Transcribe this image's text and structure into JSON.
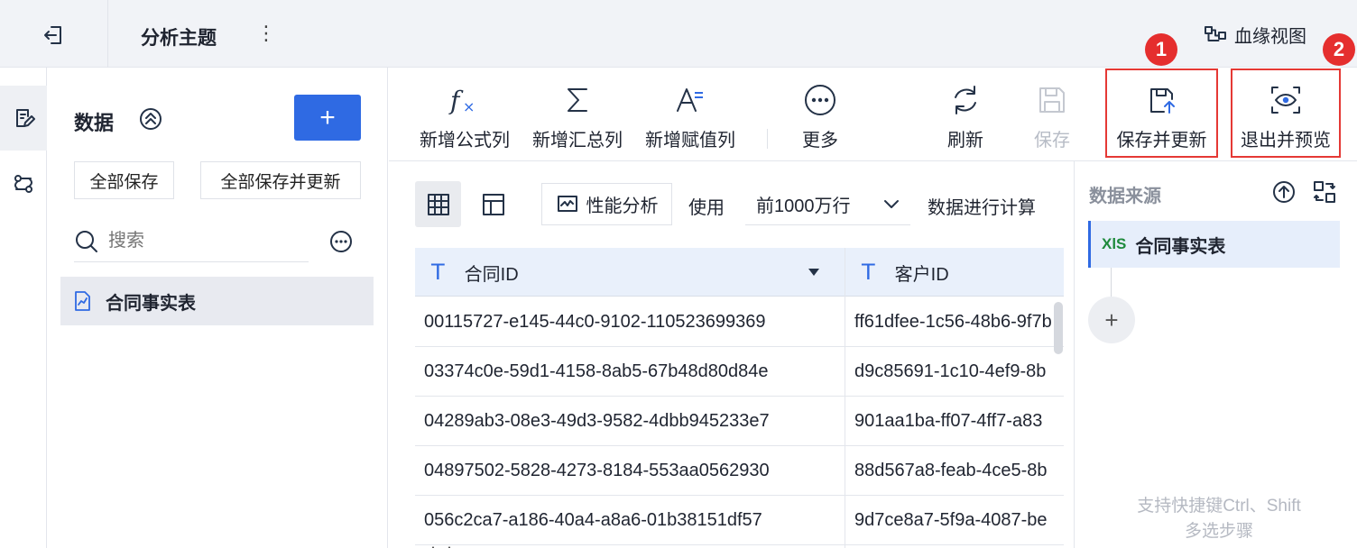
{
  "header": {
    "title": "分析主题",
    "more_icon": "⋮",
    "lineage_label": "血缘视图"
  },
  "left_panel": {
    "title": "数据",
    "add_label": "+",
    "save_all": "全部保存",
    "save_all_update": "全部保存并更新",
    "search_placeholder": "搜索",
    "table_name": "合同事实表"
  },
  "toolbar": {
    "formula_col": "新增公式列",
    "summary_col": "新增汇总列",
    "assign_col": "新增赋值列",
    "more": "更多",
    "refresh": "刷新",
    "save": "保存",
    "save_update": "保存并更新",
    "exit_preview": "退出并预览",
    "badge_1": "1",
    "badge_2": "2"
  },
  "subbar": {
    "perf_label": "性能分析",
    "use_label": "使用",
    "rows_value": "前1000万行",
    "calc_label": "数据进行计算"
  },
  "table": {
    "type_icon": "T",
    "columns": [
      "合同ID",
      "客户ID"
    ],
    "rows": [
      [
        "00115727-e145-44c0-9102-110523699369",
        "ff61dfee-1c56-48b6-9f7b"
      ],
      [
        "03374c0e-59d1-4158-8ab5-67b48d80d84e",
        "d9c85691-1c10-4ef9-8b"
      ],
      [
        "04289ab3-08e3-49d3-9582-4dbb945233e7",
        "901aa1ba-ff07-4ff7-a83"
      ],
      [
        "04897502-5828-4273-8184-553aa0562930",
        "88d567a8-feab-4ce5-8b"
      ],
      [
        "056c2ca7-a186-40a4-a8a6-01b38151df57",
        "9d7ce8a7-5f9a-4087-be"
      ]
    ]
  },
  "right_panel": {
    "title": "数据来源",
    "source_icon_text": "XlS",
    "source_name": "合同事实表",
    "add_label": "+",
    "hint_line1": "支持快捷键Ctrl、Shift",
    "hint_line2": "多选步骤"
  },
  "colors": {
    "accent": "#2f6ae3",
    "highlight": "#e53935",
    "header_bg": "#f1f3f7",
    "table_header_bg": "#e9f0fb"
  }
}
